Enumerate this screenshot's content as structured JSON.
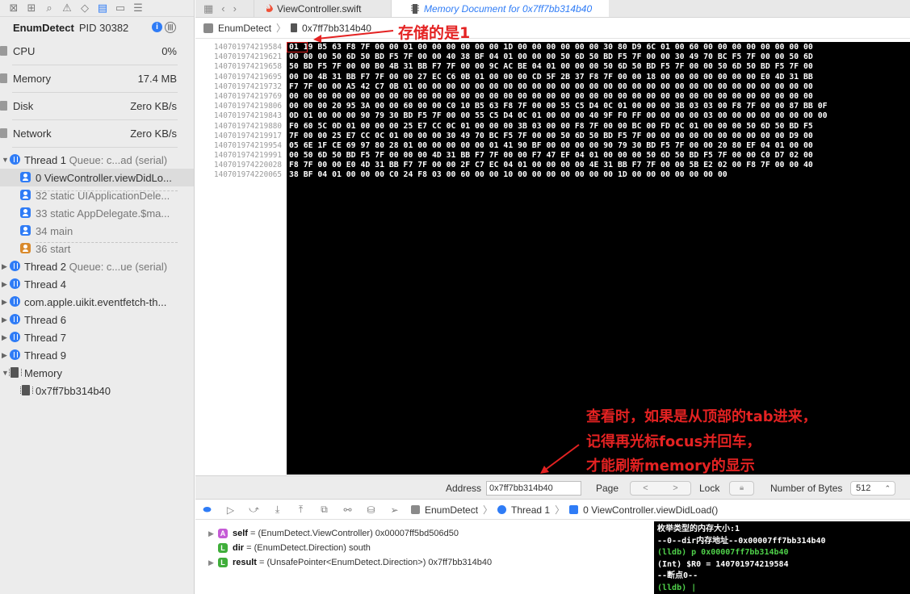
{
  "sidebar": {
    "toolbar_icons": [
      "navigator-icon",
      "hierarchy-icon",
      "find-icon",
      "issues-icon",
      "tests-icon",
      "debug-icon",
      "breakpoints-icon",
      "report-icon"
    ],
    "process": {
      "name": "EnumDetect",
      "pid": "PID 30382"
    },
    "gauges": [
      {
        "label": "CPU",
        "value": "0%"
      },
      {
        "label": "Memory",
        "value": "17.4 MB"
      },
      {
        "label": "Disk",
        "value": "Zero KB/s"
      },
      {
        "label": "Network",
        "value": "Zero KB/s"
      }
    ],
    "threads": {
      "thread1": {
        "name": "Thread 1",
        "queue": "Queue: c...ad (serial)"
      },
      "frames": [
        "0 ViewController.viewDidLo...",
        "32 static UIApplicationDele...",
        "33 static AppDelegate.$ma...",
        "34 main",
        "36 start"
      ],
      "thread2": {
        "name": "Thread 2",
        "queue": "Queue: c...ue (serial)"
      },
      "others": [
        "Thread 4",
        "com.apple.uikit.eventfetch-th...",
        "Thread 6",
        "Thread 7",
        "Thread 9"
      ]
    },
    "memory": {
      "label": "Memory",
      "item": "0x7ff7bb314b40"
    }
  },
  "tabs": [
    {
      "label": "ViewController.swift",
      "active": false
    },
    {
      "label": "Memory Document for 0x7ff7bb314b40",
      "active": true
    }
  ],
  "jumpbar": {
    "project": "EnumDetect",
    "doc": "0x7ff7bb314b40"
  },
  "memory": {
    "addresses": [
      "140701974219584",
      "140701974219621",
      "140701974219658",
      "140701974219695",
      "140701974219732",
      "140701974219769",
      "140701974219806",
      "140701974219843",
      "140701974219880",
      "140701974219917",
      "140701974219954",
      "140701974219991",
      "140701974220028",
      "140701974220065"
    ],
    "rows": [
      "01 19 B5 63 F8 7F 00 00 01 00 00 00 00 00 00 1D 00 00 00 00 00 00 30 80 D9 6C 01 00 60 00 00 00 00 00 00 00 00",
      "00 00 00 50 6D 50 BD F5 7F 00 00 40 38 BF 04 01 00 00 00 50 6D 50 BD F5 7F 00 00 30 49 70 BC F5 7F 00 00 50 6D",
      "50 BD F5 7F 00 00 B0 4B 31 BB F7 7F 00 00 9C AC BE 04 01 00 00 00 50 6D 50 BD F5 7F 00 00 50 6D 50 BD F5 7F 00",
      "00 D0 4B 31 BB F7 7F 00 00 27 EC C6 0B 01 00 00 00 CD 5F 2B 37 F8 7F 00 00 18 00 00 00 00 00 00 00 E0 4D 31 BB",
      "F7 7F 00 00 A5 42 C7 0B 01 00 00 00 00 00 00 00 00 00 00 00 00 00 00 00 00 00 00 00 00 00 00 00 00 00 00 00 00",
      "00 00 00 00 00 00 00 00 00 00 00 00 00 00 00 00 00 00 00 00 00 00 00 00 00 00 00 00 00 00 00 00 00 00 00 00 00",
      "00 00 00 20 95 3A 00 00 60 00 00 C0 10 B5 63 F8 7F 00 00 55 C5 D4 0C 01 00 00 00 3B 03 03 00 F8 7F 00 00 87 BB 0F",
      "0D 01 00 00 00 90 79 30 BD F5 7F 00 00 55 C5 D4 0C 01 00 00 00 40 9F F0 FF 00 00 00 00 03 00 00 00 00 00 00 00 00",
      "F0 60 5C 0D 01 00 00 00 25 E7 CC 0C 01 00 00 00 3B 03 00 00 F8 7F 00 00 BC 00 FD 0C 01 00 00 00 50 6D 50 BD F5",
      "7F 00 00 25 E7 CC 0C 01 00 00 00 30 49 70 BC F5 7F 00 00 50 6D 50 BD F5 7F 00 00 00 00 00 00 00 00 00 00 D9 00",
      "05 6E 1F CE 69 97 80 28 01 00 00 00 00 00 01 41 90 BF 00 00 00 00 90 79 30 BD F5 7F 00 00 20 80 EF 04 01 00 00",
      "00 50 6D 50 BD F5 7F 00 00 00 4D 31 BB F7 7F 00 00 F7 47 EF 04 01 00 00 00 50 6D 50 BD F5 7F 00 00 C0 D7 02 00",
      "F8 7F 00 00 E0 4D 31 BB F7 7F 00 00 2F C7 EC 04 01 00 00 00 00 4E 31 BB F7 7F 00 00 5B E2 02 00 F8 7F 00 00 40",
      "38 BF 04 01 00 00 00 C0 24 F8 03 00 60 00 00 10 00 00 00 00 00 00 00 1D 00 00 00 00 00 00 00"
    ]
  },
  "footer": {
    "address_label": "Address",
    "address_value": "0x7ff7bb314b40",
    "page_label": "Page",
    "page_prev": "<",
    "page_next": ">",
    "lock_label": "Lock",
    "nbytes_label": "Number of Bytes",
    "nbytes_value": "512"
  },
  "debugbar": {
    "crumbs": [
      "EnumDetect",
      "Thread 1",
      "0 ViewController.viewDidLoad()"
    ]
  },
  "variables": [
    {
      "badge": "A",
      "color": "#c55bd6",
      "expand": true,
      "name": "self",
      "value": "= (EnumDetect.ViewController) 0x00007ff5bd506d50"
    },
    {
      "badge": "L",
      "color": "#3fae3a",
      "expand": false,
      "name": "dir",
      "value": "= (EnumDetect.Direction) south"
    },
    {
      "badge": "L",
      "color": "#3fae3a",
      "expand": true,
      "name": "result",
      "value": "= (UnsafePointer<EnumDetect.Direction>) 0x7ff7bb314b40"
    }
  ],
  "console": {
    "lines": [
      {
        "text": "枚举类型的内存大小:1",
        "green": false
      },
      {
        "text": "--0--dir内存地址--0x00007ff7bb314b40",
        "green": false
      },
      {
        "text": "(lldb) p 0x00007ff7bb314b40",
        "green": true
      },
      {
        "text": "(Int) $R0 = 140701974219584",
        "green": false
      },
      {
        "text": "--断点0--",
        "green": false
      },
      {
        "text": "(lldb) |",
        "green": true
      }
    ]
  },
  "annotations": {
    "stored": "存储的是1",
    "note_lines": [
      "查看时，如果是从顶部的tab进来，",
      "记得再光标focus并回车，",
      "才能刷新memory的显示"
    ]
  },
  "colors": {
    "accent": "#2f7cf6",
    "annotation": "#e42222",
    "console_bg": "#000000",
    "hex_bg": "#000000"
  }
}
